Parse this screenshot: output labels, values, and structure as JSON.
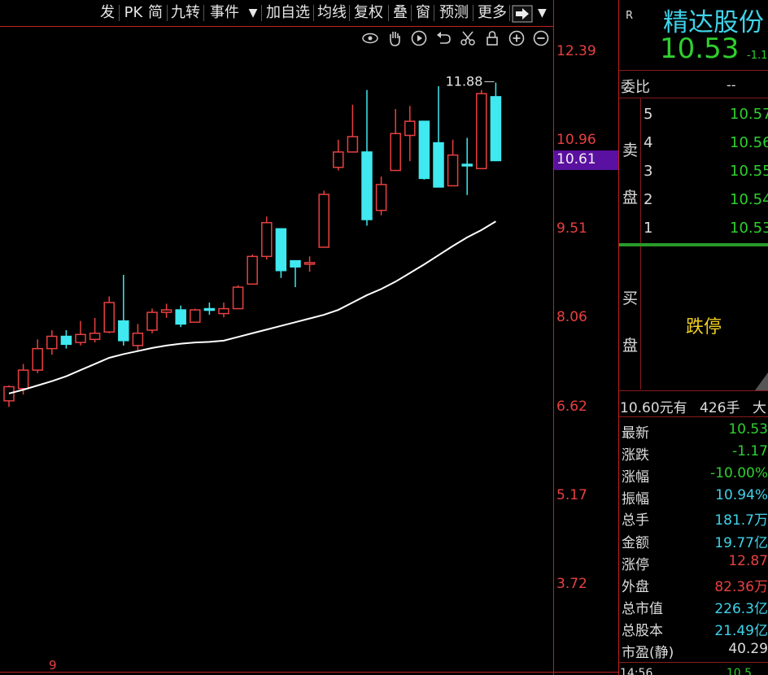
{
  "toolbar": {
    "items": [
      "发",
      "PK",
      "简",
      "九转",
      "事件",
      "▼",
      "加自选",
      "均线",
      "复权",
      "叠",
      "窗",
      "预测",
      "更多"
    ],
    "dropdown": "▼"
  },
  "chart_tools": [
    "eye-icon",
    "hand-icon",
    "play-icon",
    "undo-icon",
    "scissors-icon",
    "lock-icon",
    "zoom-in-icon",
    "zoom-out-icon"
  ],
  "chart_data": {
    "type": "candlestick",
    "y_axis_ticks": [
      "12.39",
      "10.96",
      "9.51",
      "8.06",
      "6.62",
      "5.17",
      "3.72"
    ],
    "y_tick_values": [
      12.39,
      10.96,
      9.51,
      8.06,
      6.62,
      5.17,
      3.72
    ],
    "current_price_label": "10.61",
    "current_price": 10.61,
    "max_annotation": "11.88",
    "max_value": 11.88,
    "x_label": "9",
    "candles": [
      {
        "o": 6.7,
        "h": 6.95,
        "l": 6.6,
        "c": 6.93,
        "up": true
      },
      {
        "o": 6.9,
        "h": 7.3,
        "l": 6.8,
        "c": 7.2,
        "up": true
      },
      {
        "o": 7.2,
        "h": 7.7,
        "l": 7.15,
        "c": 7.55,
        "up": true
      },
      {
        "o": 7.55,
        "h": 7.85,
        "l": 7.45,
        "c": 7.75,
        "up": true
      },
      {
        "o": 7.75,
        "h": 7.85,
        "l": 7.55,
        "c": 7.62,
        "up": false
      },
      {
        "o": 7.65,
        "h": 8.0,
        "l": 7.6,
        "c": 7.78,
        "up": true
      },
      {
        "o": 7.7,
        "h": 8.05,
        "l": 7.65,
        "c": 7.8,
        "up": true
      },
      {
        "o": 7.82,
        "h": 8.4,
        "l": 7.8,
        "c": 8.3,
        "up": true
      },
      {
        "o": 8.0,
        "h": 8.75,
        "l": 7.6,
        "c": 7.68,
        "up": false
      },
      {
        "o": 7.6,
        "h": 7.95,
        "l": 7.5,
        "c": 7.8,
        "up": true
      },
      {
        "o": 7.85,
        "h": 8.2,
        "l": 7.8,
        "c": 8.14,
        "up": true
      },
      {
        "o": 8.14,
        "h": 8.28,
        "l": 8.05,
        "c": 8.18,
        "up": true
      },
      {
        "o": 8.18,
        "h": 8.25,
        "l": 7.9,
        "c": 7.95,
        "up": false
      },
      {
        "o": 7.98,
        "h": 8.2,
        "l": 7.98,
        "c": 8.18,
        "up": true
      },
      {
        "o": 8.18,
        "h": 8.3,
        "l": 8.1,
        "c": 8.2,
        "up": false
      },
      {
        "o": 8.12,
        "h": 8.3,
        "l": 8.06,
        "c": 8.2,
        "up": true
      },
      {
        "o": 8.2,
        "h": 8.58,
        "l": 8.2,
        "c": 8.55,
        "up": true
      },
      {
        "o": 8.6,
        "h": 9.08,
        "l": 8.6,
        "c": 9.05,
        "up": true
      },
      {
        "o": 9.05,
        "h": 9.7,
        "l": 9.0,
        "c": 9.6,
        "up": true
      },
      {
        "o": 9.5,
        "h": 9.5,
        "l": 8.7,
        "c": 8.82,
        "up": false
      },
      {
        "o": 8.88,
        "h": 8.95,
        "l": 8.55,
        "c": 8.98,
        "up": false
      },
      {
        "o": 8.95,
        "h": 9.05,
        "l": 8.8,
        "c": 8.95,
        "up": true
      },
      {
        "o": 9.2,
        "h": 10.12,
        "l": 9.2,
        "c": 10.06,
        "up": true
      },
      {
        "o": 10.5,
        "h": 10.95,
        "l": 10.45,
        "c": 10.75,
        "up": true
      },
      {
        "o": 10.75,
        "h": 11.52,
        "l": 10.75,
        "c": 11.0,
        "up": true
      },
      {
        "o": 10.75,
        "h": 11.76,
        "l": 9.55,
        "c": 9.65,
        "up": false
      },
      {
        "o": 9.8,
        "h": 10.35,
        "l": 9.72,
        "c": 10.22,
        "up": true
      },
      {
        "o": 10.45,
        "h": 11.45,
        "l": 10.45,
        "c": 11.05,
        "up": true
      },
      {
        "o": 11.02,
        "h": 11.5,
        "l": 10.6,
        "c": 11.25,
        "up": true
      },
      {
        "o": 11.25,
        "h": 11.25,
        "l": 10.3,
        "c": 10.32,
        "up": false
      },
      {
        "o": 10.9,
        "h": 11.82,
        "l": 10.18,
        "c": 10.18,
        "up": false
      },
      {
        "o": 10.2,
        "h": 10.95,
        "l": 10.2,
        "c": 10.7,
        "up": true
      },
      {
        "o": 10.55,
        "h": 10.98,
        "l": 10.05,
        "c": 10.55,
        "up": false
      },
      {
        "o": 10.48,
        "h": 11.76,
        "l": 10.48,
        "c": 11.7,
        "up": true
      },
      {
        "o": 11.65,
        "h": 11.88,
        "l": 10.6,
        "c": 10.61,
        "up": false
      }
    ],
    "ma": [
      6.82,
      6.88,
      6.95,
      7.02,
      7.1,
      7.2,
      7.3,
      7.4,
      7.46,
      7.51,
      7.56,
      7.6,
      7.63,
      7.65,
      7.66,
      7.68,
      7.74,
      7.8,
      7.86,
      7.92,
      7.98,
      8.04,
      8.1,
      8.18,
      8.3,
      8.42,
      8.52,
      8.64,
      8.78,
      8.92,
      9.07,
      9.22,
      9.36,
      9.48,
      9.62
    ]
  },
  "quote": {
    "r_mark": "R",
    "name": "精达股份",
    "price": "10.53",
    "change_short": "-1.1",
    "weibi_label": "委比",
    "weibi_value": "--",
    "sell_label_1": "卖",
    "sell_label_2": "盘",
    "buy_label_1": "买",
    "buy_label_2": "盘",
    "sell_levels": [
      {
        "level": "5",
        "price": "10.57"
      },
      {
        "level": "4",
        "price": "10.56"
      },
      {
        "level": "3",
        "price": "10.55"
      },
      {
        "level": "2",
        "price": "10.54"
      },
      {
        "level": "1",
        "price": "10.53"
      }
    ],
    "limit_status": "跌停",
    "trade_price": "10.60元有",
    "trade_vol": "426手",
    "trade_dir": "大",
    "stats": [
      {
        "label": "最新",
        "value": "10.53",
        "color": "#2fcf2f"
      },
      {
        "label": "涨跌",
        "value": "-1.17",
        "color": "#2fcf2f"
      },
      {
        "label": "涨幅",
        "value": "-10.00%",
        "color": "#2fcf2f"
      },
      {
        "label": "振幅",
        "value": "10.94%",
        "color": "#3fd3e8"
      },
      {
        "label": "总手",
        "value": "181.7万",
        "color": "#3fd3e8"
      },
      {
        "label": "金额",
        "value": "19.77亿",
        "color": "#3fd3e8"
      },
      {
        "label": "涨停",
        "value": "12.87",
        "color": "#e84040"
      },
      {
        "label": "外盘",
        "value": "82.36万",
        "color": "#e84040"
      },
      {
        "label": "总市值",
        "value": "226.3亿",
        "color": "#3fd3e8"
      },
      {
        "label": "总股本",
        "value": "21.49亿",
        "color": "#3fd3e8"
      },
      {
        "label": "市盈(静)",
        "value": "40.29",
        "color": "#dddddd"
      }
    ],
    "bottom_time": "14:56",
    "bottom_price": "10.5"
  },
  "colors": {
    "up": "#e84040",
    "down": "#40e8f0",
    "ma": "#ffffff",
    "grid_red": "#c02020",
    "current_box": "#5a10a0"
  }
}
